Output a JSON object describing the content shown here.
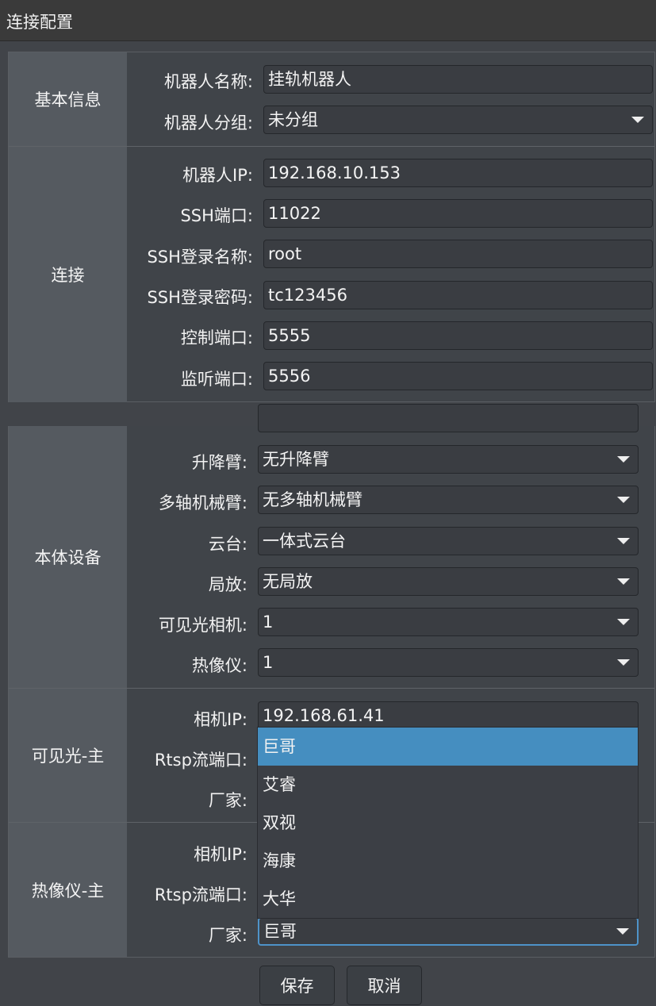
{
  "window": {
    "title": "连接配置"
  },
  "basic": {
    "section_label": "基本信息",
    "robot_name": {
      "label": "机器人名称:",
      "value": "挂轨机器人"
    },
    "robot_group": {
      "label": "机器人分组:",
      "value": "未分组"
    }
  },
  "connection": {
    "section_label": "连接",
    "robot_ip": {
      "label": "机器人IP:",
      "value": "192.168.10.153"
    },
    "ssh_port": {
      "label": "SSH端口:",
      "value": "11022"
    },
    "ssh_user": {
      "label": "SSH登录名称:",
      "value": "root"
    },
    "ssh_password": {
      "label": "SSH登录密码:",
      "value": "tc123456"
    },
    "control_port": {
      "label": "控制端口:",
      "value": "5555"
    },
    "listen_port": {
      "label": "监听端口:",
      "value": "5556"
    }
  },
  "body_device": {
    "section_label": "本体设备",
    "lift_arm": {
      "label": "升降臂:",
      "value": "无升降臂"
    },
    "multi_axis_arm": {
      "label": "多轴机械臂:",
      "value": "无多轴机械臂"
    },
    "ptz": {
      "label": "云台:",
      "value": "一体式云台"
    },
    "local_release": {
      "label": "局放:",
      "value": "无局放"
    },
    "visible_camera": {
      "label": "可见光相机:",
      "value": "1"
    },
    "thermal_imager": {
      "label": "热像仪:",
      "value": "1"
    }
  },
  "visible_main": {
    "section_label": "可见光-主",
    "camera_ip": {
      "label": "相机IP:",
      "value": "192.168.61.41"
    },
    "rtsp_port": {
      "label": "Rtsp流端口:"
    },
    "vendor": {
      "label": "厂家:"
    }
  },
  "thermal_main": {
    "section_label": "热像仪-主",
    "camera_ip": {
      "label": "相机IP:"
    },
    "rtsp_port": {
      "label": "Rtsp流端口:"
    },
    "vendor": {
      "label": "厂家:",
      "value": "巨哥"
    }
  },
  "vendor_dropdown": {
    "options": [
      "巨哥",
      "艾睿",
      "双视",
      "海康",
      "大华"
    ],
    "selected": "巨哥"
  },
  "buttons": {
    "save": "保存",
    "cancel": "取消"
  },
  "colors": {
    "selection": "#458ec0",
    "focus_border": "#4e93c9",
    "section_bg": "#555a60"
  }
}
